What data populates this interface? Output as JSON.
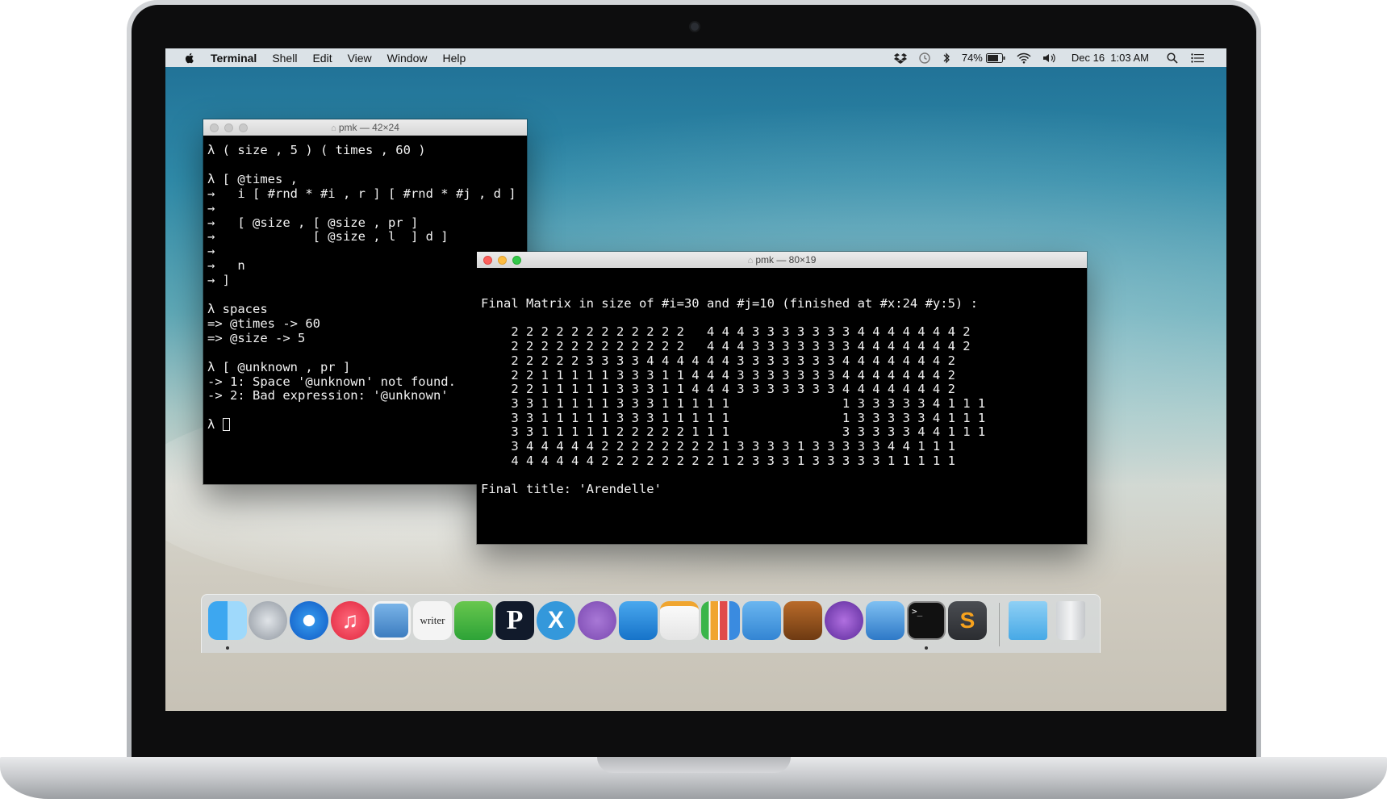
{
  "menubar": {
    "app_name": "Terminal",
    "items": [
      "Shell",
      "Edit",
      "View",
      "Window",
      "Help"
    ],
    "battery": "74%",
    "clock": "Dec 16  1:03 AM"
  },
  "window_small": {
    "title": "pmk — 42×24",
    "lines": [
      "λ ( size , 5 ) ( times , 60 )",
      "",
      "λ [ @times ,",
      "→   i [ #rnd * #i , r ] [ #rnd * #j , d ]",
      "→",
      "→   [ @size , [ @size , pr ]",
      "→             [ @size , l  ] d ]",
      "→",
      "→   n",
      "→ ]",
      "",
      "λ spaces",
      "=> @times -> 60",
      "=> @size -> 5",
      "",
      "λ [ @unknown , pr ]",
      "-> 1: Space '@unknown' not found.",
      "-> 2: Bad expression: '@unknown'",
      "",
      "λ "
    ]
  },
  "window_large": {
    "title": "pmk — 80×19",
    "lines": [
      "Final Matrix in size of #i=30 and #j=10 (finished at #x:24 #y:5) :",
      "",
      "    2 2 2 2 2 2 2 2 2 2 2 2   4 4 4 3 3 3 3 3 3 3 4 4 4 4 4 4 4 2",
      "    2 2 2 2 2 2 2 2 2 2 2 2   4 4 4 3 3 3 3 3 3 3 4 4 4 4 4 4 4 2",
      "    2 2 2 2 2 3 3 3 3 4 4 4 4 4 4 3 3 3 3 3 3 3 4 4 4 4 4 4 4 2",
      "    2 2 1 1 1 1 1 3 3 3 1 1 4 4 4 3 3 3 3 3 3 3 4 4 4 4 4 4 4 2",
      "    2 2 1 1 1 1 1 3 3 3 1 1 4 4 4 3 3 3 3 3 3 3 4 4 4 4 4 4 4 2",
      "    3 3 1 1 1 1 1 3 3 3 1 1 1 1 1               1 3 3 3 3 3 4 1 1 1",
      "    3 3 1 1 1 1 1 3 3 3 1 1 1 1 1               1 3 3 3 3 3 4 1 1 1",
      "    3 3 1 1 1 1 1 2 2 2 2 2 1 1 1               3 3 3 3 3 4 4 1 1 1",
      "    3 4 4 4 4 4 2 2 2 2 2 2 2 2 1 3 3 3 3 1 3 3 3 3 3 4 4 1 1 1",
      "    4 4 4 4 4 4 2 2 2 2 2 2 2 2 1 2 3 3 3 1 3 3 3 3 3 1 1 1 1 1",
      "",
      "Final title: 'Arendelle'"
    ]
  },
  "dock": {
    "icons": [
      "finder-icon",
      "launchpad-icon",
      "safari-icon",
      "itunes-icon",
      "preview-icon",
      "writer-icon",
      "evernote-icon",
      "p-app-icon",
      "xamarin-icon",
      "github-icon",
      "lego-icon",
      "pages-icon",
      "numbers-icon",
      "keynote-icon",
      "garageband-icon",
      "imovie-icon",
      "xcode-icon",
      "terminal-icon",
      "sublime-icon",
      "downloads-folder-icon",
      "trash-icon"
    ],
    "labels": {
      "writer": "writer",
      "p_app": "P",
      "xamarin": "X"
    }
  },
  "colors": {
    "terminal_bg": "#000000",
    "terminal_fg": "#f2f2f2",
    "close": "#fc605c",
    "minimize": "#fdbc40",
    "zoom": "#34c84a"
  }
}
